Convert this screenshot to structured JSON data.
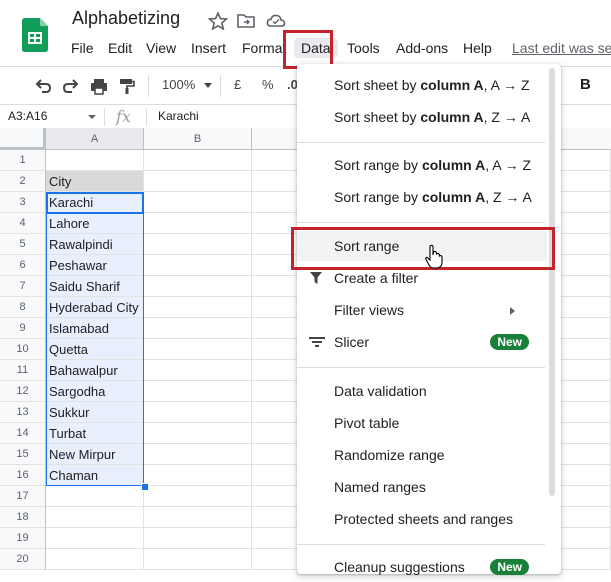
{
  "doc": {
    "title": "Alphabetizing",
    "last_edit": "Last edit was se"
  },
  "menu": {
    "items": [
      "File",
      "Edit",
      "View",
      "Insert",
      "Format",
      "Data",
      "Tools",
      "Add-ons",
      "Help"
    ],
    "active": "Data"
  },
  "toolbar": {
    "zoom": "100%",
    "currency": "£",
    "percent": "%",
    "decimal": ".0",
    "bold": "B"
  },
  "formula_bar": {
    "name_box": "A3:A16",
    "fx": "fx",
    "value": "Karachi"
  },
  "grid": {
    "columns": [
      "A",
      "B"
    ],
    "rows": [
      "1",
      "2",
      "3",
      "4",
      "5",
      "6",
      "7",
      "8",
      "9",
      "10",
      "11",
      "12",
      "13",
      "14",
      "15",
      "16",
      "17",
      "18",
      "19",
      "20"
    ],
    "cells": {
      "A2": "City",
      "A3": "Karachi",
      "A4": "Lahore",
      "A5": "Rawalpindi",
      "A6": "Peshawar",
      "A7": "Saidu Sharif",
      "A8": "Hyderabad City",
      "A9": "Islamabad",
      "A10": "Quetta",
      "A11": "Bahawalpur",
      "A12": "Sargodha",
      "A13": "Sukkur",
      "A14": "Turbat",
      "A15": "New Mirpur",
      "A16": "Chaman"
    }
  },
  "data_menu": {
    "sort_sheet_az": {
      "pre": "Sort sheet by ",
      "bold": "column A",
      "post": ", A → Z"
    },
    "sort_sheet_za": {
      "pre": "Sort sheet by ",
      "bold": "column A",
      "post": ", Z → A"
    },
    "sort_range_az": {
      "pre": "Sort range by ",
      "bold": "column A",
      "post": ", A → Z"
    },
    "sort_range_za": {
      "pre": "Sort range by ",
      "bold": "column A",
      "post": ", Z → A"
    },
    "sort_range": "Sort range",
    "create_filter": "Create a filter",
    "filter_views": "Filter views",
    "slicer": "Slicer",
    "slicer_badge": "New",
    "data_validation": "Data validation",
    "pivot_table": "Pivot table",
    "randomize_range": "Randomize range",
    "named_ranges": "Named ranges",
    "protected_ranges": "Protected sheets and ranges",
    "cleanup_suggestions": "Cleanup suggestions",
    "cleanup_badge": "New"
  },
  "colors": {
    "accent_red": "#c5232b",
    "selection_fill": "#e8f0fe",
    "selection_border": "#1a73e8",
    "header_fill": "#d9d9d9",
    "badge_green": "#188038"
  }
}
